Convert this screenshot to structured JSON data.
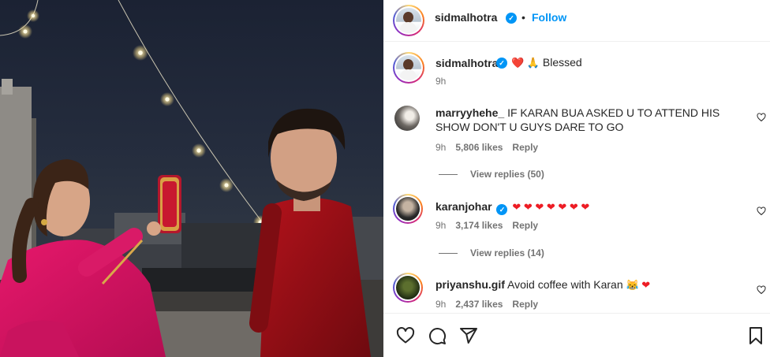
{
  "post": {
    "author": "sidmalhotra",
    "follow_label": "Follow",
    "separator": "•",
    "caption_text": "Blessed",
    "caption_emojis": "❤️ 🙏",
    "caption_time": "9h"
  },
  "comments": [
    {
      "username": "marryyhehe_",
      "text": "IF KARAN BUA ASKED U TO ATTEND HIS SHOW DON'T U GUYS DARE TO GO",
      "time": "9h",
      "likes": "5,806 likes",
      "reply_label": "Reply",
      "view_replies": "View replies (50)"
    },
    {
      "username": "karanjohar",
      "text": "❤ ❤ ❤ ❤ ❤ ❤ ❤",
      "time": "9h",
      "likes": "3,174 likes",
      "reply_label": "Reply",
      "view_replies": "View replies (14)"
    },
    {
      "username": "priyanshu.gif",
      "text": "Avoid coffee with Karan",
      "emojis": "😹 ❤",
      "time": "9h",
      "likes": "2,437 likes",
      "reply_label": "Reply"
    }
  ],
  "icons": [
    "heart-icon",
    "comment-icon",
    "share-icon",
    "bookmark-icon",
    "verified-badge-icon"
  ],
  "colors": {
    "accent": "#0095f6",
    "heart": "#ed1c24",
    "muted": "#737373"
  }
}
